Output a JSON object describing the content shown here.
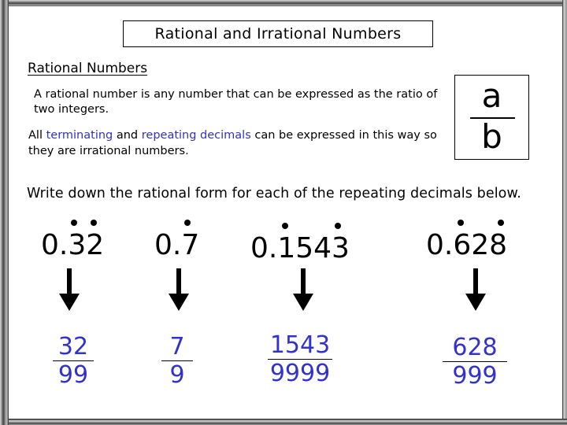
{
  "slide": {
    "title": "Rational and Irrational Numbers",
    "section_heading": "Rational Numbers",
    "definition": "A rational number is any number that can be expressed as the ratio of two integers.",
    "explanation": {
      "part1": "All ",
      "highlight1": "terminating",
      "part2": " and ",
      "highlight2": "repeating decimals",
      "part3": " can be expressed in this way so they are irrational numbers."
    },
    "fraction_symbol": {
      "numerator": "a",
      "denominator": "b"
    },
    "instruction": "Write down the rational form for each of the repeating decimals below."
  },
  "colors": {
    "highlight_blue": "#3333bb",
    "answer_blue": "#3333cc",
    "text": "#000000"
  },
  "examples": [
    {
      "decimal": "0.32",
      "repeating_digits": "32",
      "answer_numerator": "32",
      "answer_denominator": "99"
    },
    {
      "decimal": "0.7",
      "repeating_digits": "7",
      "answer_numerator": "7",
      "answer_denominator": "9"
    },
    {
      "decimal": "0.1543",
      "repeating_digits": "1543",
      "answer_numerator": "1543",
      "answer_denominator": "9999"
    },
    {
      "decimal": "0.628",
      "repeating_digits": "628",
      "answer_numerator": "628",
      "answer_denominator": "999"
    }
  ]
}
